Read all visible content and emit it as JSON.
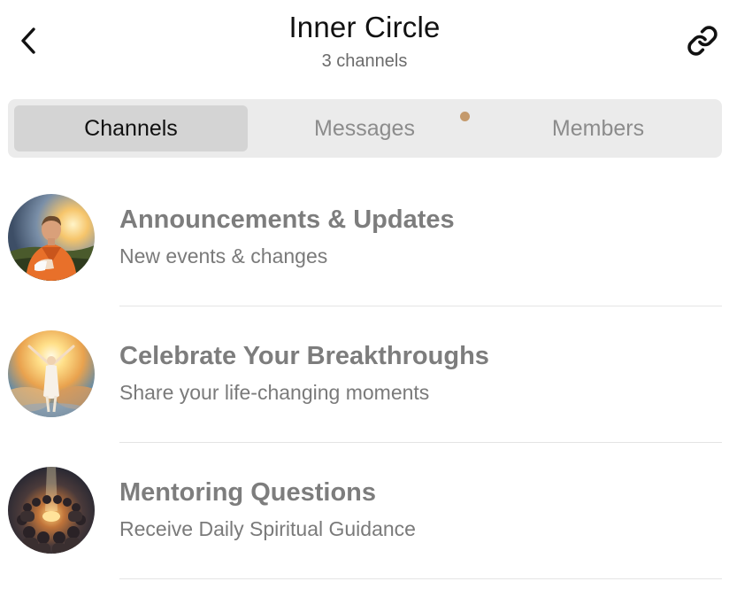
{
  "header": {
    "title": "Inner Circle",
    "subtitle": "3 channels",
    "back_icon": "chevron-left-icon",
    "link_icon": "link-icon"
  },
  "tabs": [
    {
      "label": "Channels",
      "active": true
    },
    {
      "label": "Messages",
      "active": false,
      "unread_dot": true
    },
    {
      "label": "Members",
      "active": false
    }
  ],
  "colors": {
    "active_tab_bg": "#d4d4d4",
    "tab_bar_bg": "#ebebeb",
    "unread_dot": "#c49a6c",
    "channel_title": "#7d7d7d"
  },
  "channels": [
    {
      "title": "Announcements & Updates",
      "description": "New events & changes",
      "avatar": "mentor-portrait-avatar"
    },
    {
      "title": "Celebrate Your Breakthroughs",
      "description": "Share your life-changing moments",
      "avatar": "radiant-figure-avatar"
    },
    {
      "title": "Mentoring Questions",
      "description": "Receive Daily Spiritual Guidance",
      "avatar": "gathering-circle-avatar"
    }
  ]
}
